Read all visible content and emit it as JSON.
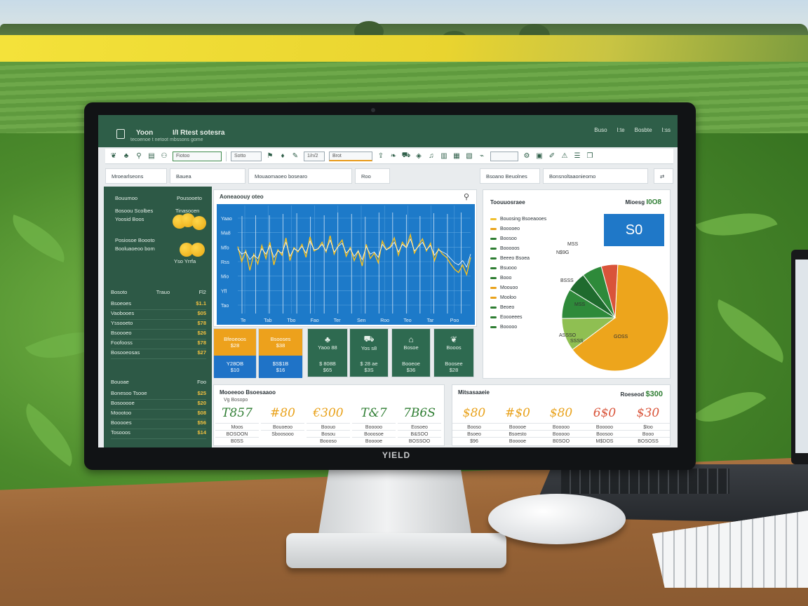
{
  "titlebar": {
    "app_name": "Yoon",
    "title": "I/I Rtest sotesra",
    "subtitle": "tecoenoe t netoot mbssons gome",
    "menu": [
      "Buso",
      "I:te",
      "Bosbte",
      "I:ss"
    ]
  },
  "toolbar": {
    "fields": [
      "Fiotoo",
      "Sotto",
      "Brot",
      "1/n/2"
    ]
  },
  "filters": [
    "Mroearlseons",
    "Bauea",
    "Mouaomaoeo bosearo",
    "Roo",
    "Bsoano Beuolnes",
    "Bonsnoltaaonieomo"
  ],
  "leftpanel": {
    "head1": "Bouumoo",
    "head1b": "Pousooeto",
    "line2a": "Bosoou Scolbes",
    "line2b": "Tinasocen",
    "line3": "Yoosid Boos",
    "line4a": "Posiosoe Boooto",
    "line4b": "Booluaoeoo bom",
    "line4c": "Yso Yrrfa",
    "section1": {
      "left": "Bosoto",
      "mid": "Trauo",
      "right": "Fl2"
    },
    "rows1": [
      {
        "label": "Bsoeoes",
        "value": "$1.1"
      },
      {
        "label": "Vaobooes",
        "value": "$05"
      },
      {
        "label": "Yssooeto",
        "value": "$78"
      },
      {
        "label": "Bsoooeo",
        "value": "$26"
      },
      {
        "label": "Foofooss",
        "value": "$78"
      },
      {
        "label": "Bosooeosas",
        "value": "$27"
      }
    ],
    "section2": {
      "left": "Bouoae",
      "right": "Foo"
    },
    "rows2": [
      {
        "label": "Bonesoo Tsooe",
        "value": "$25"
      },
      {
        "label": "Bosooooe",
        "value": "$20"
      },
      {
        "label": "Moootoo",
        "value": "$08"
      },
      {
        "label": "Booooes",
        "value": "$56"
      },
      {
        "label": "Tosooos",
        "value": "$14"
      }
    ]
  },
  "linechart": {
    "title": "Aoneaoouy oteo",
    "search_icon": "search-icon"
  },
  "chart_data": {
    "type": "line",
    "title": "Aoneaoouy oteo",
    "ytick_labels": [
      "Yaao",
      "Ma8",
      "Mfo",
      "Rss",
      "Mio",
      "Yfl",
      "Tao"
    ],
    "xtick_labels": [
      "Te",
      "Tab",
      "Tbo",
      "Fao",
      "Ter",
      "Sen",
      "Roo",
      "Teo",
      "Tar",
      "Poo"
    ],
    "series": [
      {
        "color": "#f5c020",
        "values": [
          62,
          48,
          58,
          40,
          55,
          46,
          63,
          51,
          66,
          45,
          59,
          54,
          70,
          49,
          61,
          57,
          64,
          52,
          71,
          58,
          60,
          66,
          57,
          72,
          55,
          63,
          68,
          53,
          61,
          49,
          58,
          44,
          64,
          51,
          56,
          47,
          67,
          59,
          62,
          70,
          54,
          66,
          61,
          73,
          56,
          63,
          69,
          58,
          65,
          49,
          60,
          55,
          52,
          46,
          41,
          38,
          45,
          36,
          52
        ]
      },
      {
        "color": "#ffffff",
        "values": [
          60,
          55,
          57,
          50,
          54,
          51,
          60,
          55,
          63,
          52,
          58,
          56,
          66,
          53,
          60,
          58,
          62,
          56,
          67,
          59,
          60,
          64,
          58,
          68,
          57,
          62,
          65,
          56,
          60,
          53,
          58,
          50,
          62,
          55,
          57,
          52,
          64,
          59,
          61,
          66,
          57,
          64,
          61,
          69,
          58,
          62,
          66,
          59,
          63,
          54,
          59,
          57,
          55,
          51,
          47,
          45,
          49,
          43,
          55
        ]
      }
    ],
    "spikes": [
      12,
      4,
      18,
      9,
      22,
      6,
      25,
      14,
      30,
      20,
      35,
      42,
      38,
      47,
      50,
      44,
      56
    ],
    "ylim": [
      0,
      100
    ],
    "grid": true
  },
  "tiles": [
    {
      "top1": "Bfeoeoos",
      "top2": "$28",
      "bot1": "Y28OB",
      "bot2": "$10",
      "style": "orange"
    },
    {
      "top1": "Bsooses",
      "top2": "$38",
      "bot1": "$S$1B",
      "bot2": "$16",
      "style": "orange"
    },
    {
      "top1": "Yaoo 88",
      "bot1": "$ 808B",
      "bot2": "$65",
      "icon": "sprout-icon",
      "style": "green"
    },
    {
      "top1": "Yos s8",
      "bot1": "$ 28 ae",
      "bot2": "$3S",
      "icon": "tractor-icon",
      "style": "green"
    },
    {
      "top1": "Bosoe",
      "bot1": "Booeoe",
      "bot2": "$36",
      "icon": "barn-icon",
      "style": "green"
    },
    {
      "top1": "Booos",
      "bot1": "Boosee",
      "bot2": "$28",
      "icon": "seed-icon",
      "style": "green"
    }
  ],
  "piepanel": {
    "title": "Toouuosraee",
    "right_label": "Mioesg",
    "right_value": "I0O8",
    "big_value": "S0",
    "legend": [
      {
        "label": "Bouosing Bsoeaooes",
        "color": "#f0c030"
      },
      {
        "label": "Booooeo",
        "color": "#e9a21b"
      },
      {
        "label": "Boosoo",
        "color": "#2e7d32"
      },
      {
        "label": "Booooos",
        "color": "#2e7d32"
      },
      {
        "label": "Beeeo Bsoea",
        "color": "#2e7d32"
      },
      {
        "label": "Bsuooo",
        "color": "#2e7d32"
      },
      {
        "label": "Booo",
        "color": "#2e7d32"
      },
      {
        "label": "Moouoo",
        "color": "#e9a21b"
      },
      {
        "label": "Mooloo",
        "color": "#e9a21b"
      },
      {
        "label": "Beoeo",
        "color": "#2e7d32"
      },
      {
        "label": "Eoooeees",
        "color": "#2e7d32"
      },
      {
        "label": "Booooo",
        "color": "#2e7d32"
      }
    ],
    "slice_labels": [
      "MSS",
      "N$9G",
      "BSSS",
      "MSS",
      "ASSSO",
      "SSSS",
      "GOSS"
    ],
    "slices": [
      {
        "value": 64,
        "color": "#eda51c"
      },
      {
        "value": 10,
        "color": "#8fbf52"
      },
      {
        "value": 9,
        "color": "#2e8a3a"
      },
      {
        "value": 6,
        "color": "#1f6b2e"
      },
      {
        "value": 6,
        "color": "#2e8a3a"
      },
      {
        "value": 5,
        "color": "#d9543a"
      }
    ]
  },
  "kpi_left": {
    "title": "Mooeeoo Bsoesaaoo",
    "sub": "Vg Bosopo",
    "cells": [
      {
        "value": "T857",
        "label1": "Moos",
        "label2": "BOSOON",
        "label3": "B0SS",
        "color": "#2e7d32"
      },
      {
        "value": "#80",
        "label1": "Bouoeoo",
        "label2": "Sboosooo",
        "label3": "",
        "color": "#e9a21b"
      },
      {
        "value": "€300",
        "label1": "Boouo",
        "label2": "Bosou",
        "label3": "Boooso",
        "color": "#e9a21b"
      },
      {
        "value": "T&7",
        "label1": "Booooo",
        "label2": "Booosoe",
        "label3": "Booooe",
        "color": "#2e7d32"
      },
      {
        "value": "7B6S",
        "label1": "Eosoeo",
        "label2": "B&SOO",
        "label3": "BOSSOO",
        "color": "#2e7d32"
      }
    ]
  },
  "kpi_right": {
    "title": "Mitsasaaeie",
    "right_label": "Roeseod",
    "right_value": "$300",
    "cells": [
      {
        "value": "$80",
        "label1": "Booso",
        "label2": "Bsoeo",
        "label3": "$96",
        "color": "#e9a21b"
      },
      {
        "value": "#$0",
        "label1": "Booooe",
        "label2": "Bsoesto",
        "label3": "Booooe",
        "color": "#e9a21b"
      },
      {
        "value": "$80",
        "label1": "Booooo",
        "label2": "Booooo",
        "label3": "B0SOO",
        "color": "#e9a21b"
      },
      {
        "value": "6$0",
        "label1": "Booooo",
        "label2": "Boosoo",
        "label3": "M$DOS",
        "color": "#d9543a"
      },
      {
        "value": "$30",
        "label1": "$Ioo",
        "label2": "Booo",
        "label3": "BOSOSS",
        "color": "#d9543a"
      }
    ]
  },
  "monitor_brand": "YIELD",
  "colors": {
    "primary_green": "#2e5e48",
    "accent_orange": "#eda11c",
    "accent_blue": "#1f78c8"
  }
}
